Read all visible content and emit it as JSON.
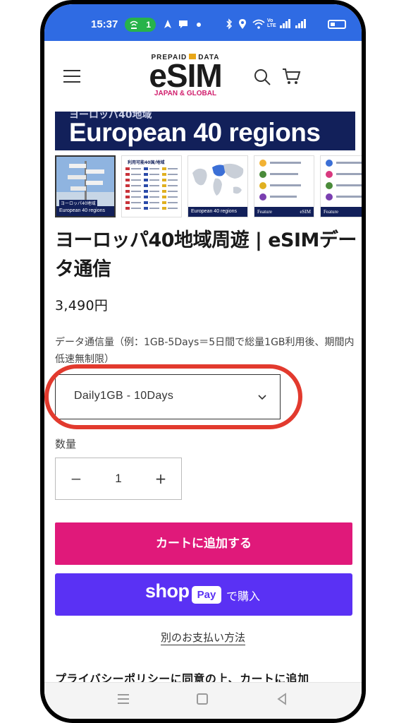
{
  "status_bar": {
    "time": "15:37",
    "hotspot_count": "1",
    "icons": [
      "navigation-icon",
      "chat-icon",
      "dot-icon",
      "bluetooth-icon",
      "location-icon",
      "wifi-icon",
      "volte-icon",
      "signal-icon",
      "signal-icon",
      "battery-icon"
    ],
    "volte_label": "Vo LTE"
  },
  "header": {
    "logo_prepaid": "PREPAID",
    "logo_data": "DATA",
    "logo_main": "eSIM",
    "logo_sub": "JAPAN & GLOBAL"
  },
  "banner": {
    "small_text": "ヨーロッパ40地域",
    "big_text": "European 40 regions"
  },
  "thumbnails": [
    {
      "caption": "European 40 regions",
      "sub": "ヨーロッパ40地域"
    },
    {
      "caption": "",
      "sub": "利用可能40国/地域"
    },
    {
      "caption": "European 40 regions",
      "sub": ""
    },
    {
      "caption_left": "Feature",
      "caption_right": "eSIM"
    },
    {
      "caption_left": "Feature",
      "caption_right": ""
    }
  ],
  "product": {
    "title": "ヨーロッパ40地域周遊 | eSIMデータ通信",
    "price": "3,490円",
    "option_label": "データ通信量（例：1GB-5Days＝5日間で総量1GB利用後、期間内低速無制限）",
    "selected_option": "Daily1GB - 10Days",
    "quantity_label": "数量",
    "quantity_value": "1",
    "minus_symbol": "−",
    "plus_symbol": "+"
  },
  "buttons": {
    "add_to_cart": "カートに追加する",
    "shop_text": "shop",
    "pay_text": "Pay",
    "buy_text": "で購入",
    "other_payment": "別のお支払い方法"
  },
  "footer_text": "プライバシーポリシーに同意の上、カートに追加",
  "colors": {
    "status_bar": "#2f6be3",
    "cart_button": "#e0197a",
    "shoppay": "#5a31f4",
    "highlight": "#e23a2e",
    "banner": "#12205a"
  }
}
